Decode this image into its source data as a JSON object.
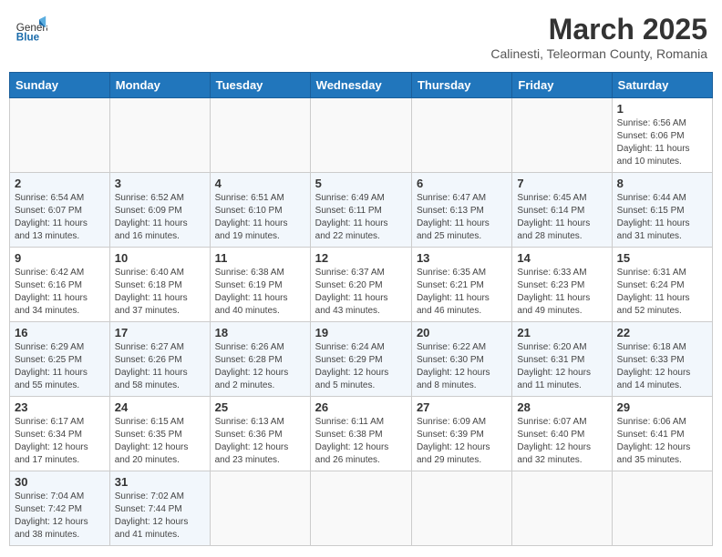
{
  "header": {
    "logo_general": "General",
    "logo_blue": "Blue",
    "month_title": "March 2025",
    "location": "Calinesti, Teleorman County, Romania"
  },
  "days_of_week": [
    "Sunday",
    "Monday",
    "Tuesday",
    "Wednesday",
    "Thursday",
    "Friday",
    "Saturday"
  ],
  "weeks": [
    [
      {
        "day": null,
        "info": null
      },
      {
        "day": null,
        "info": null
      },
      {
        "day": null,
        "info": null
      },
      {
        "day": null,
        "info": null
      },
      {
        "day": null,
        "info": null
      },
      {
        "day": null,
        "info": null
      },
      {
        "day": "1",
        "info": "Sunrise: 6:56 AM\nSunset: 6:06 PM\nDaylight: 11 hours\nand 10 minutes."
      }
    ],
    [
      {
        "day": "2",
        "info": "Sunrise: 6:54 AM\nSunset: 6:07 PM\nDaylight: 11 hours\nand 13 minutes."
      },
      {
        "day": "3",
        "info": "Sunrise: 6:52 AM\nSunset: 6:09 PM\nDaylight: 11 hours\nand 16 minutes."
      },
      {
        "day": "4",
        "info": "Sunrise: 6:51 AM\nSunset: 6:10 PM\nDaylight: 11 hours\nand 19 minutes."
      },
      {
        "day": "5",
        "info": "Sunrise: 6:49 AM\nSunset: 6:11 PM\nDaylight: 11 hours\nand 22 minutes."
      },
      {
        "day": "6",
        "info": "Sunrise: 6:47 AM\nSunset: 6:13 PM\nDaylight: 11 hours\nand 25 minutes."
      },
      {
        "day": "7",
        "info": "Sunrise: 6:45 AM\nSunset: 6:14 PM\nDaylight: 11 hours\nand 28 minutes."
      },
      {
        "day": "8",
        "info": "Sunrise: 6:44 AM\nSunset: 6:15 PM\nDaylight: 11 hours\nand 31 minutes."
      }
    ],
    [
      {
        "day": "9",
        "info": "Sunrise: 6:42 AM\nSunset: 6:16 PM\nDaylight: 11 hours\nand 34 minutes."
      },
      {
        "day": "10",
        "info": "Sunrise: 6:40 AM\nSunset: 6:18 PM\nDaylight: 11 hours\nand 37 minutes."
      },
      {
        "day": "11",
        "info": "Sunrise: 6:38 AM\nSunset: 6:19 PM\nDaylight: 11 hours\nand 40 minutes."
      },
      {
        "day": "12",
        "info": "Sunrise: 6:37 AM\nSunset: 6:20 PM\nDaylight: 11 hours\nand 43 minutes."
      },
      {
        "day": "13",
        "info": "Sunrise: 6:35 AM\nSunset: 6:21 PM\nDaylight: 11 hours\nand 46 minutes."
      },
      {
        "day": "14",
        "info": "Sunrise: 6:33 AM\nSunset: 6:23 PM\nDaylight: 11 hours\nand 49 minutes."
      },
      {
        "day": "15",
        "info": "Sunrise: 6:31 AM\nSunset: 6:24 PM\nDaylight: 11 hours\nand 52 minutes."
      }
    ],
    [
      {
        "day": "16",
        "info": "Sunrise: 6:29 AM\nSunset: 6:25 PM\nDaylight: 11 hours\nand 55 minutes."
      },
      {
        "day": "17",
        "info": "Sunrise: 6:27 AM\nSunset: 6:26 PM\nDaylight: 11 hours\nand 58 minutes."
      },
      {
        "day": "18",
        "info": "Sunrise: 6:26 AM\nSunset: 6:28 PM\nDaylight: 12 hours\nand 2 minutes."
      },
      {
        "day": "19",
        "info": "Sunrise: 6:24 AM\nSunset: 6:29 PM\nDaylight: 12 hours\nand 5 minutes."
      },
      {
        "day": "20",
        "info": "Sunrise: 6:22 AM\nSunset: 6:30 PM\nDaylight: 12 hours\nand 8 minutes."
      },
      {
        "day": "21",
        "info": "Sunrise: 6:20 AM\nSunset: 6:31 PM\nDaylight: 12 hours\nand 11 minutes."
      },
      {
        "day": "22",
        "info": "Sunrise: 6:18 AM\nSunset: 6:33 PM\nDaylight: 12 hours\nand 14 minutes."
      }
    ],
    [
      {
        "day": "23",
        "info": "Sunrise: 6:17 AM\nSunset: 6:34 PM\nDaylight: 12 hours\nand 17 minutes."
      },
      {
        "day": "24",
        "info": "Sunrise: 6:15 AM\nSunset: 6:35 PM\nDaylight: 12 hours\nand 20 minutes."
      },
      {
        "day": "25",
        "info": "Sunrise: 6:13 AM\nSunset: 6:36 PM\nDaylight: 12 hours\nand 23 minutes."
      },
      {
        "day": "26",
        "info": "Sunrise: 6:11 AM\nSunset: 6:38 PM\nDaylight: 12 hours\nand 26 minutes."
      },
      {
        "day": "27",
        "info": "Sunrise: 6:09 AM\nSunset: 6:39 PM\nDaylight: 12 hours\nand 29 minutes."
      },
      {
        "day": "28",
        "info": "Sunrise: 6:07 AM\nSunset: 6:40 PM\nDaylight: 12 hours\nand 32 minutes."
      },
      {
        "day": "29",
        "info": "Sunrise: 6:06 AM\nSunset: 6:41 PM\nDaylight: 12 hours\nand 35 minutes."
      }
    ],
    [
      {
        "day": "30",
        "info": "Sunrise: 7:04 AM\nSunset: 7:42 PM\nDaylight: 12 hours\nand 38 minutes."
      },
      {
        "day": "31",
        "info": "Sunrise: 7:02 AM\nSunset: 7:44 PM\nDaylight: 12 hours\nand 41 minutes."
      },
      {
        "day": null,
        "info": null
      },
      {
        "day": null,
        "info": null
      },
      {
        "day": null,
        "info": null
      },
      {
        "day": null,
        "info": null
      },
      {
        "day": null,
        "info": null
      }
    ]
  ]
}
